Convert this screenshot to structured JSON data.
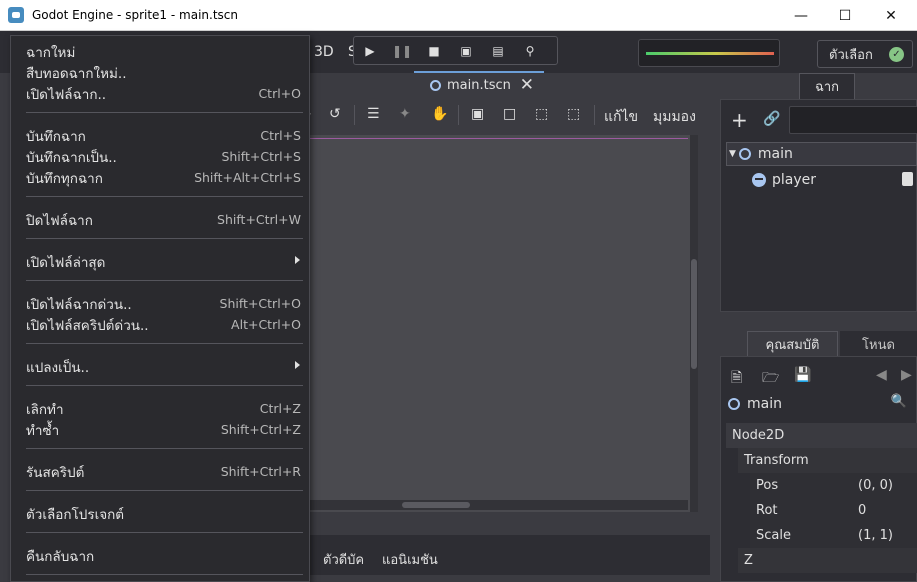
{
  "window": {
    "title": "Godot Engine - sprite1 - main.tscn",
    "min_icon": "minimize-icon",
    "max_icon": "maximize-icon",
    "close_icon": "close-icon"
  },
  "editor": {
    "mode_3d": "3D",
    "mode_script": "S",
    "options_label": "ตัวเลือก",
    "scene_tab": "main.tscn",
    "viewport_tools": {
      "edit": "แก้ไข",
      "view": "มุมมอง"
    },
    "bottom_tabs": [
      "ตัวดีบัค",
      "แอนิเมชัน"
    ]
  },
  "scene_dock": {
    "tab": "ฉาก",
    "nodes": [
      {
        "name": "main",
        "icon": "node2d-icon"
      },
      {
        "name": "player",
        "icon": "sprite-icon"
      }
    ]
  },
  "inspector": {
    "tab_active": "คุณสมบัติ",
    "tab_other": "โหนด",
    "node_name": "main",
    "category": "Node2D",
    "section": "Transform",
    "properties": [
      {
        "name": "Pos",
        "value": "(0, 0)"
      },
      {
        "name": "Rot",
        "value": "0"
      },
      {
        "name": "Scale",
        "value": "(1, 1)"
      }
    ],
    "next_section": "Z"
  },
  "file_menu": {
    "items": [
      {
        "label": "ฉากใหม่",
        "shortcut": ""
      },
      {
        "label": "สืบทอดฉากใหม่..",
        "shortcut": ""
      },
      {
        "label": "เปิดไฟล์ฉาก..",
        "shortcut": "Ctrl+O"
      },
      {
        "label": "บันทึกฉาก",
        "shortcut": "Ctrl+S"
      },
      {
        "label": "บันทึกฉากเป็น..",
        "shortcut": "Shift+Ctrl+S"
      },
      {
        "label": "บันทึกทุกฉาก",
        "shortcut": "Shift+Alt+Ctrl+S"
      },
      {
        "label": "ปิดไฟล์ฉาก",
        "shortcut": "Shift+Ctrl+W"
      },
      {
        "label": "เปิดไฟล์ล่าสุด",
        "shortcut": ""
      },
      {
        "label": "เปิดไฟล์ฉากด่วน..",
        "shortcut": "Shift+Ctrl+O"
      },
      {
        "label": "เปิดไฟล์สคริปต์ด่วน..",
        "shortcut": "Alt+Ctrl+O"
      },
      {
        "label": "แปลงเป็น..",
        "shortcut": ""
      },
      {
        "label": "เลิกทำ",
        "shortcut": "Ctrl+Z"
      },
      {
        "label": "ทำซ้ำ",
        "shortcut": "Shift+Ctrl+Z"
      },
      {
        "label": "รันสคริปต์",
        "shortcut": "Shift+Ctrl+R"
      },
      {
        "label": "ตัวเลือกโปรเจกต์",
        "shortcut": ""
      },
      {
        "label": "คืนกลับฉาก",
        "shortcut": ""
      }
    ]
  }
}
